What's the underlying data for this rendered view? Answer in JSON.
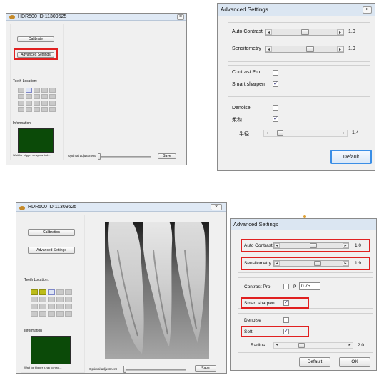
{
  "top_left": {
    "title": "HDR500  ID:11309625",
    "calibrate_label": "Calibrate",
    "advanced_label": "Advanced Settings",
    "teeth_location_label": "Teeth Location:",
    "information_label": "Information",
    "wait_text": "Wait for trigger x-ray control...",
    "optimal_label": "Optimal adjustment",
    "save_label": "Save",
    "optimal_value_percent": 0
  },
  "top_right": {
    "title": "Advanced Settings",
    "auto_contrast_label": "Auto Contrast",
    "auto_contrast_value": "1.0",
    "sensitometry_label": "Sensitometry",
    "sensitometry_value": "1.9",
    "contrast_pro_label": "Contrast Pro",
    "contrast_pro_checked": false,
    "smart_sharpen_label": "Smart sharpen",
    "smart_sharpen_checked": true,
    "denoise_label": "Denoise",
    "denoise_checked": false,
    "soft_label": "柔和",
    "soft_checked": true,
    "radius_label": "半径",
    "radius_value": "1.4",
    "default_label": "Default",
    "arrow_left": "◂",
    "arrow_right": "▸",
    "check_mark": "✓"
  },
  "bottom_left": {
    "title": "HDR500  ID:11309625",
    "calibrate_label": "Calibration",
    "advanced_label": "Advanced Settings",
    "teeth_location_label": "Teeth Location:",
    "information_label": "Information",
    "wait_text": "Wait for trigger x-ray control...",
    "optimal_label": "Optimal adjustment",
    "save_label": "Save"
  },
  "bottom_right": {
    "title": "Advanced Settings",
    "auto_contrast_label": "Auto Contrast",
    "auto_contrast_value": "1.0",
    "sensitometry_label": "Sensitometry",
    "sensitometry_value": "1.9",
    "contrast_pro_label": "Contrast Pro",
    "contrast_pro_checked": false,
    "p_label": "P",
    "p_value": "0.75",
    "smart_sharpen_label": "Smart sharpen",
    "smart_sharpen_checked": true,
    "denoise_label": "Denoise",
    "denoise_checked": false,
    "soft_label": "Soft",
    "soft_checked": true,
    "radius_label": "Radius",
    "radius_value": "2.0",
    "default_label": "Default",
    "ok_label": "OK",
    "arrow_left": "◂",
    "arrow_right": "▸",
    "check_mark": "✓"
  },
  "colors": {
    "highlight_red": "#e02020",
    "info_green": "#0b4a08",
    "title_bg": "#dfe9f5",
    "tooth_selected_yellow": "#bcbc18"
  }
}
